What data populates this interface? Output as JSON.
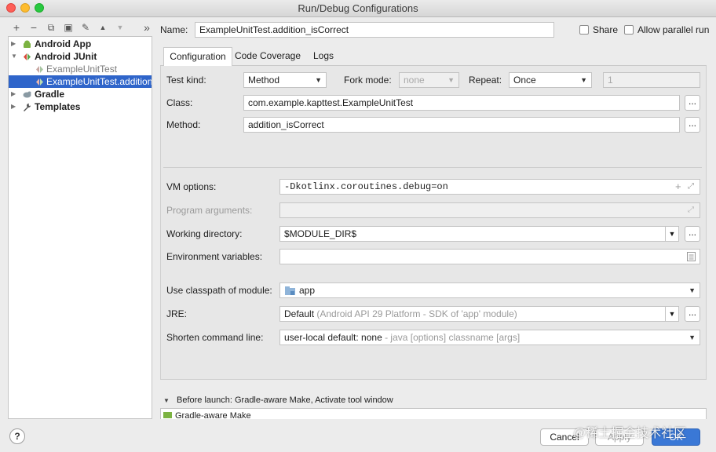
{
  "window": {
    "title": "Run/Debug Configurations"
  },
  "toolbar": {
    "add_icon": "+",
    "remove_icon": "−",
    "copy_icon": "⧉",
    "save_icon": "▣",
    "edit_icon": "✎",
    "up_icon": "▲",
    "down_icon": "▼",
    "more_icon": "»"
  },
  "tree": {
    "items": [
      {
        "label": "Android App"
      },
      {
        "label": "Android JUnit"
      },
      {
        "label": "ExampleUnitTest"
      },
      {
        "label": "ExampleUnitTest.addition_isCorrect"
      },
      {
        "label": "Gradle"
      },
      {
        "label": "Templates"
      }
    ]
  },
  "header": {
    "name_label": "Name:",
    "name_value": "ExampleUnitTest.addition_isCorrect",
    "share_label": "Share",
    "parallel_label": "Allow parallel run"
  },
  "tabs": [
    {
      "label": "Configuration"
    },
    {
      "label": "Code Coverage"
    },
    {
      "label": "Logs"
    }
  ],
  "config": {
    "test_kind_label": "Test kind:",
    "test_kind_value": "Method",
    "fork_mode_label": "Fork mode:",
    "fork_mode_value": "none",
    "repeat_label": "Repeat:",
    "repeat_value": "Once",
    "repeat_count": "1",
    "class_label": "Class:",
    "class_value": "com.example.kapttest.ExampleUnitTest",
    "method_label": "Method:",
    "method_value": "addition_isCorrect",
    "vm_label": "VM options:",
    "vm_value": "-Dkotlinx.coroutines.debug=on",
    "program_args_label": "Program arguments:",
    "working_dir_label": "Working directory:",
    "working_dir_value": "$MODULE_DIR$",
    "env_label": "Environment variables:",
    "classpath_label": "Use classpath of module:",
    "classpath_value": "app",
    "jre_label": "JRE:",
    "jre_value": "Default",
    "jre_hint": "(Android API 29 Platform - SDK of 'app' module)",
    "shorten_label": "Shorten command line:",
    "shorten_value": "user-local default: none",
    "shorten_hint": "- java [options] classname [args]",
    "ellipsis": "..."
  },
  "before_launch": {
    "label": "Before launch: Gradle-aware Make, Activate tool window",
    "item": "Gradle-aware Make"
  },
  "footer": {
    "help": "?",
    "cancel": "Cancel",
    "apply": "Apply",
    "ok": "OK"
  },
  "watermark": "@稀土掘金技术社区",
  "colors": {
    "accent": "#2f65ca",
    "primary_button": "#3a78d6"
  }
}
